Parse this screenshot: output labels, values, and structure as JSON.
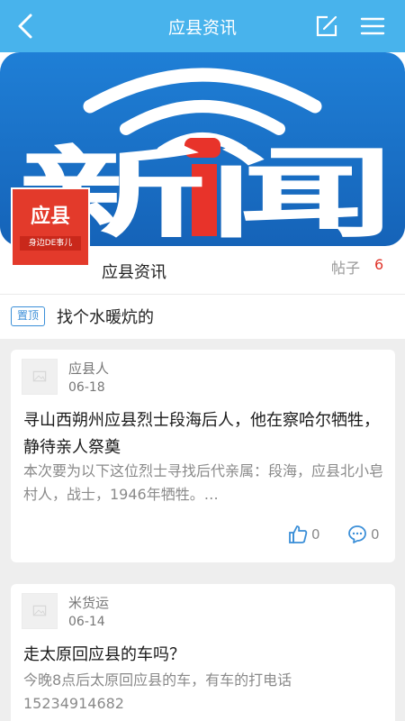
{
  "header": {
    "title": "应县资讯",
    "back_icon": "chevron-left-icon",
    "edit_icon": "edit-icon",
    "menu_icon": "menu-icon",
    "bar_color": "#48b3ec"
  },
  "banner": {
    "text": "新闻",
    "background_color": "#1a6fc6"
  },
  "forum": {
    "avatar_title": "应县",
    "avatar_subtitle": "身边DE事儿",
    "name": "应县资讯",
    "posts_label": "帖子",
    "posts_count": "6"
  },
  "pinned": {
    "badge": "置顶",
    "title": "找个水暖炕的"
  },
  "posts": [
    {
      "author": "应县人",
      "date": "06-18",
      "title": "寻山西朔州应县烈士段海后人，他在察哈尔牺牲，静待亲人祭奠",
      "body": "本次要为以下这位烈士寻找后代亲属：段海，应县北小皂村人，战士，1946年牺牲。…",
      "likes": "0",
      "comments": "0"
    },
    {
      "author": "米货运",
      "date": "06-14",
      "title": "走太原回应县的车吗？",
      "body": "今晚8点后太原回应县的车，有车的打电话15234914682"
    }
  ]
}
